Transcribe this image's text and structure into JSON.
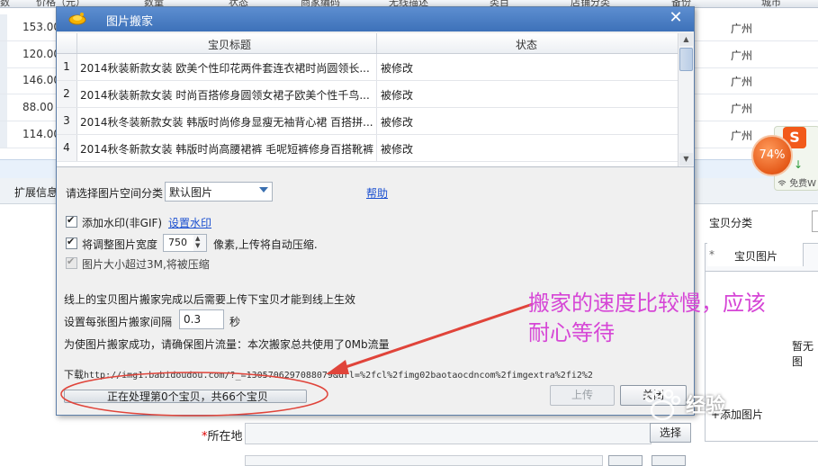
{
  "background": {
    "header_columns": [
      "数",
      "价格（元）",
      "数量",
      "状态",
      "商家编码",
      "无线描述",
      "类目",
      "店铺分类",
      "备份",
      "城市"
    ],
    "rows": [
      {
        "price": "153.00",
        "city": "广州"
      },
      {
        "price": "120.00",
        "city": "广州"
      },
      {
        "price": "146.00",
        "city": "广州"
      },
      {
        "price": "88.00",
        "city": "广州"
      },
      {
        "price": "114.00",
        "city": "广州"
      }
    ],
    "toolbar_label": "扩展信息",
    "right_panel": {
      "category_label": "宝贝分类",
      "tab_label": "宝贝图片",
      "tab_star": "*",
      "empty_text": "暂无图",
      "add_picture": "+添加图片"
    },
    "bottom_form": {
      "location_required": "*",
      "location_label": "所在地",
      "choose_button": "选择"
    }
  },
  "floating_widget": {
    "percent": "74%",
    "logo": "S",
    "arrow": "↓",
    "free_label": "免费W"
  },
  "dialog": {
    "title": "图片搬家",
    "close_symbol": "✕",
    "grid": {
      "columns": [
        "宝贝标题",
        "状态"
      ],
      "rows": [
        {
          "num": "1",
          "title": "2014秋装新款女装 欧美个性印花两件套连衣裙时尚圆领长...",
          "status": "被修改"
        },
        {
          "num": "2",
          "title": "2014秋装新款女装 时尚百搭修身圆领女裙子欧美个性千鸟...",
          "status": "被修改"
        },
        {
          "num": "3",
          "title": "2014秋冬装新款女装 韩版时尚修身显瘦无袖背心裙 百搭拼...",
          "status": "被修改"
        },
        {
          "num": "4",
          "title": "2014秋冬新款女装 韩版时尚高腰裙裤 毛呢短裤修身百搭靴裤",
          "status": "被修改"
        }
      ]
    },
    "category": {
      "label": "请选择图片空间分类",
      "value": "默认图片"
    },
    "help_link": "帮助",
    "watermark": {
      "label": "添加水印(非GIF)",
      "link": "设置水印",
      "checked": true
    },
    "resize": {
      "label": "将调整图片宽度",
      "value": "750",
      "suffix": "像素,上传将自动压缩.",
      "checked": true
    },
    "size_limit": {
      "label": "图片大小超过3M,将被压缩",
      "checked": true
    },
    "note_upload": "线上的宝贝图片搬家完成以后需要上传下宝贝才能到线上生效",
    "interval": {
      "label": "设置每张图片搬家间隔",
      "value": "0.3",
      "unit": "秒"
    },
    "traffic_note": "为使图片搬家成功，请确保图片流量：本次搬家总共使用了0Mb流量",
    "download": {
      "label": "下载",
      "url": "http://img1.babidoudou.com/?_=1305706297088079&url=%2fcl%2fimg02baotaocdncom%2fimgextra%2fi2%2"
    },
    "progress_text": "正在处理第0个宝贝，共66个宝贝",
    "progress": 0,
    "upload_button": "上传",
    "close_button": "关闭"
  },
  "annotation": {
    "line1": "搬家的速度比较慢，应该",
    "line2": "耐心等待",
    "color": "#d646d6"
  },
  "site_watermark": "经验"
}
